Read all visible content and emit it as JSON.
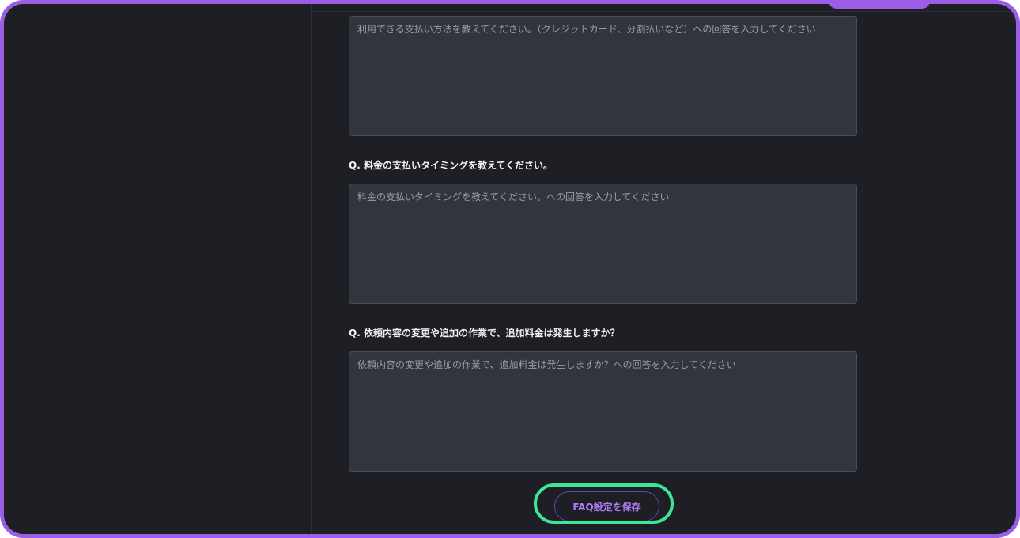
{
  "faq": {
    "q1": {
      "placeholder": "利用できる支払い方法を教えてください。（クレジットカード、分割払いなど）への回答を入力してください"
    },
    "q2": {
      "question": "Q. 料金の支払いタイミングを教えてください。",
      "placeholder": "料金の支払いタイミングを教えてください。への回答を入力してください"
    },
    "q3": {
      "question": "Q. 依頼内容の変更や追加の作業で、追加料金は発生しますか？",
      "placeholder": "依頼内容の変更や追加の作業で、追加料金は発生しますか？への回答を入力してください"
    },
    "save_label": "FAQ設定を保存"
  },
  "colors": {
    "frame_border": "#9b5de5",
    "background": "#1e1f24",
    "field_background": "#32353d",
    "highlight": "#3ee69a",
    "button_text": "#b07cf0"
  }
}
